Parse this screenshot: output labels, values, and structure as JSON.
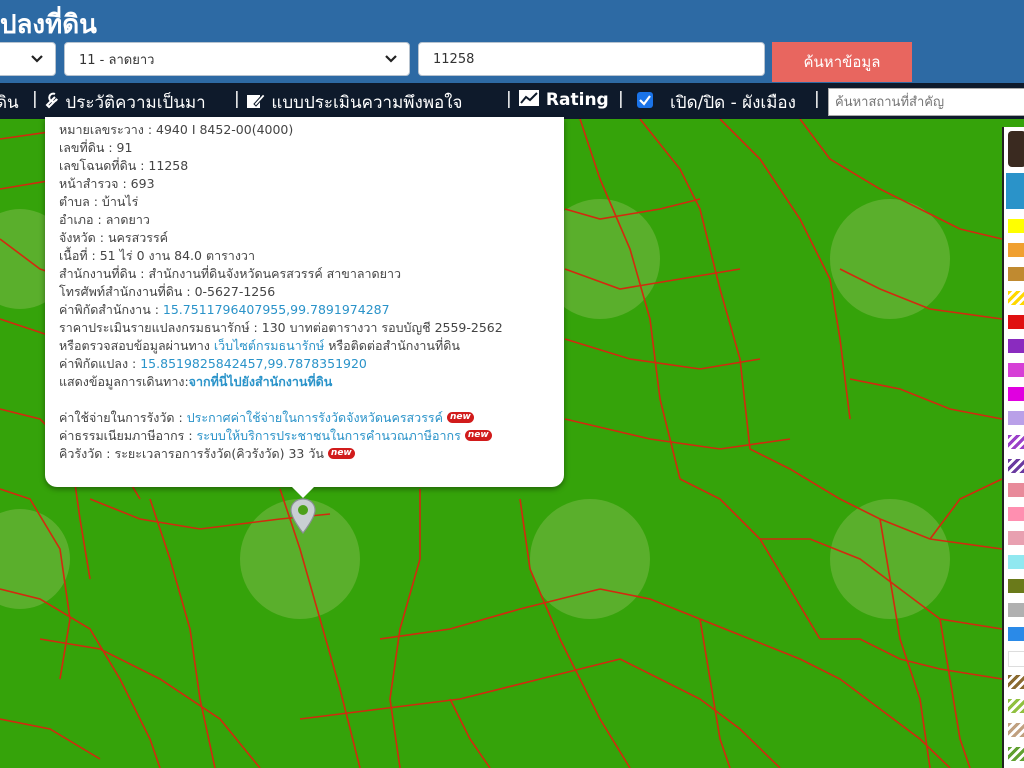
{
  "header": {
    "title": "ปลงที่ดิน",
    "district_select": "11 - ลาดยาว",
    "parcel_input": "11258",
    "search_button": "ค้นหาข้อมูล"
  },
  "nav": {
    "items": [
      "ดิน",
      "ประวัติความเป็นมา",
      "แบบประเมินความพึงพอใจ",
      "Rating",
      "เปิด/ปิด - ผังเมือง"
    ],
    "separator": "|",
    "search_placeholder": "ค้นหาสถานที่สำคัญ"
  },
  "popup": {
    "map_sheet": "หมายเลขระวาง : 4940 I 8452-00(4000)",
    "land_no": "เลขที่ดิน : 91",
    "deed_no": "เลขโฉนดที่ดิน : 11258",
    "survey_page": "หน้าสำรวจ : 693",
    "subdistrict": "ตำบล : บ้านไร่",
    "district": "อำเภอ : ลาดยาว",
    "province": "จังหวัด : นครสวรรค์",
    "area": "เนื้อที่ : 51 ไร่ 0 งาน 84.0 ตารางวา",
    "office": "สำนักงานที่ดิน : สำนักงานที่ดินจังหวัดนครสวรรค์ สาขาลาดยาว",
    "office_phone": "โทรศัพท์สำนักงานที่ดิน : 0-5627-1256",
    "office_coord_label": "ค่าพิกัดสำนักงาน : ",
    "office_coord": "15.7511796407955,99.7891974287",
    "appraisal": "ราคาประเมินรายแปลงกรมธนารักษ์ : 130 บาทต่อตารางวา รอบบัญชี 2559-2562",
    "check_prefix": "หรือตรวจสอบข้อมูลผ่านทาง ",
    "check_link": "เว็บไซต์กรมธนารักษ์",
    "check_suffix": " หรือติดต่อสำนักงานที่ดิน",
    "parcel_coord_label": "ค่าพิกัดแปลง : ",
    "parcel_coord": "15.8519825842457,99.7878351920",
    "route_label": "แสดงข้อมูลการเดินทาง:",
    "route_link": "จากที่นี่ไปยังสำนักงานที่ดิน",
    "survey_cost_label": "ค่าใช้จ่ายในการรังวัด : ",
    "survey_cost_link": "ประกาศค่าใช้จ่ายในการรังวัดจังหวัดนครสวรรค์",
    "fee_label": "ค่าธรรมเนียมภาษีอากร : ",
    "fee_link": "ระบบให้บริการประชาชนในการคำนวณภาษีอากร",
    "queue_text": "คิวรังวัด : ระยะเวลารอการรังวัด(คิวรังวัด) 33 วัน",
    "new_badge": "new"
  },
  "legend": {
    "colors": [
      "#ffff00",
      "#f0a030",
      "#c08a30",
      "#ffd800",
      "#e01010",
      "#8a2bbf",
      "#d63fd6",
      "#e000e0",
      "#b9a0e8",
      "#9a40c8",
      "#6a3aa0",
      "#e88a9a",
      "#ff8fb0",
      "#e8a0b0",
      "#90e8f0",
      "#6a7a1a",
      "#b0b0b0",
      "#2a8ae8",
      "#ffffff",
      "#8a6a30",
      "#90c040",
      "#c0a080",
      "#60a030"
    ]
  },
  "colors": {
    "header_bg": "#2d6aa4",
    "nav_bg": "#0e1a2b",
    "map_green": "#35a30a",
    "parcel_line": "#d22a0e",
    "search_button": "#e8665f",
    "link": "#2a93c9"
  }
}
